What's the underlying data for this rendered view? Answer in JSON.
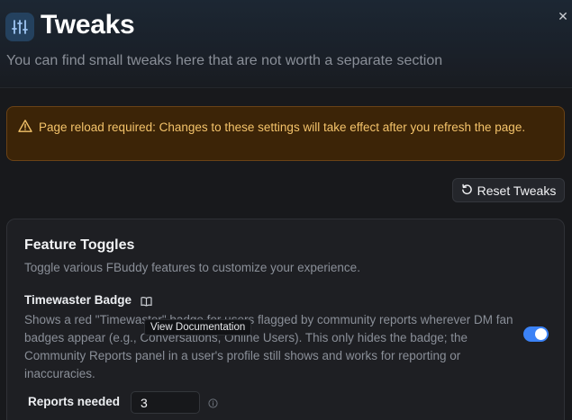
{
  "header": {
    "title": "Tweaks",
    "subtitle": "You can find small tweaks here that are not worth a separate section",
    "title_icon": "sliders-icon",
    "close_icon": "close-icon",
    "close_glyph": "✕"
  },
  "warning": {
    "icon": "warning-icon",
    "text": "Page reload required: Changes to these settings will take effect after you refresh the page."
  },
  "toolbar": {
    "reset_label": "Reset Tweaks",
    "reset_icon": "reset-icon"
  },
  "feature_toggles": {
    "title": "Feature Toggles",
    "description": "Toggle various FBuddy features to customize your experience.",
    "timewaster_badge": {
      "label": "Timewaster Badge",
      "doc_icon": "book-icon",
      "description": "Shows a red \"Timewaster\" badge for users flagged by community reports wherever DM fan badges appear (e.g., Conversations, Online Users). This only hides the badge; the Community Reports panel in a user's profile still shows and works for reporting or inaccuracies.",
      "tooltip": "View Documentation",
      "enabled": true
    },
    "reports_needed": {
      "label": "Reports needed",
      "value": "3",
      "info_icon": "info-icon"
    }
  },
  "colors": {
    "accent": "#3b82f6",
    "warning_bg": "#3c2407",
    "warning_text": "#f4c36a",
    "background": "#18191c"
  }
}
